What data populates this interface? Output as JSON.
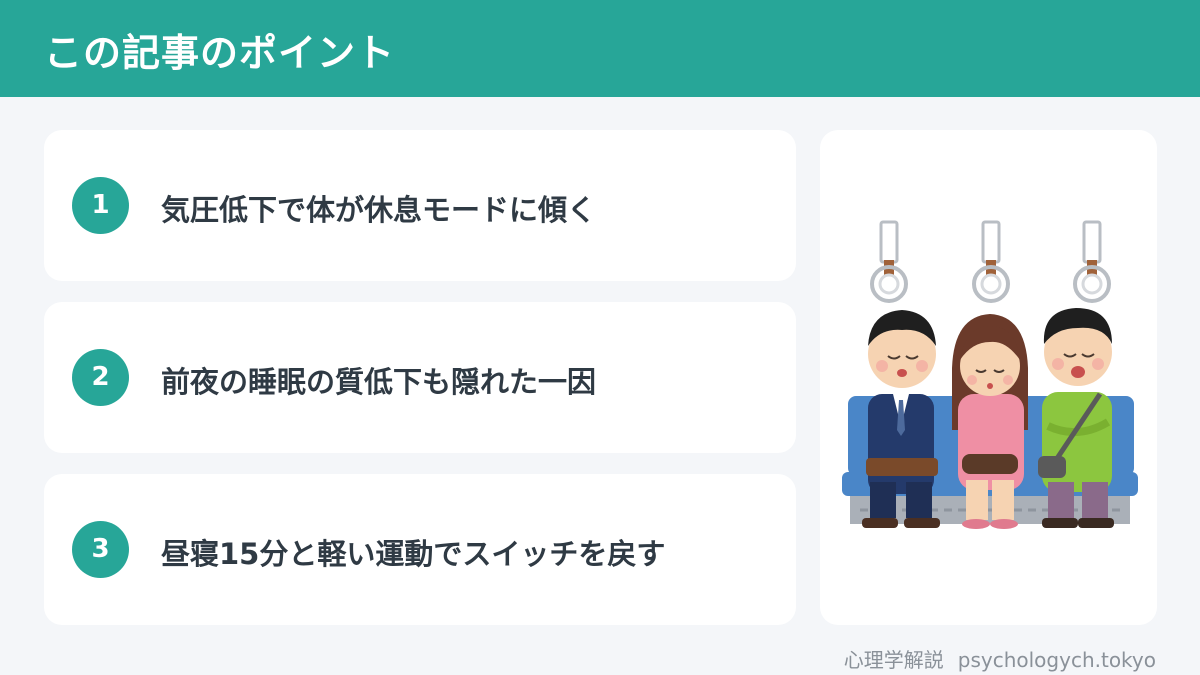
{
  "header": {
    "title": "この記事のポイント"
  },
  "points": [
    {
      "number": "1",
      "text": "気圧低下で体が休息モードに傾く"
    },
    {
      "number": "2",
      "text": "前夜の睡眠の質低下も隠れた一因"
    },
    {
      "number": "3",
      "text": "昼寝15分と軽い運動でスイッチを戻す"
    }
  ],
  "footer": {
    "brand": "心理学解説",
    "site": "psychologych.tokyo"
  },
  "colors": {
    "accent": "#27a698",
    "text": "#2f3a44",
    "background": "#f4f6f9"
  }
}
